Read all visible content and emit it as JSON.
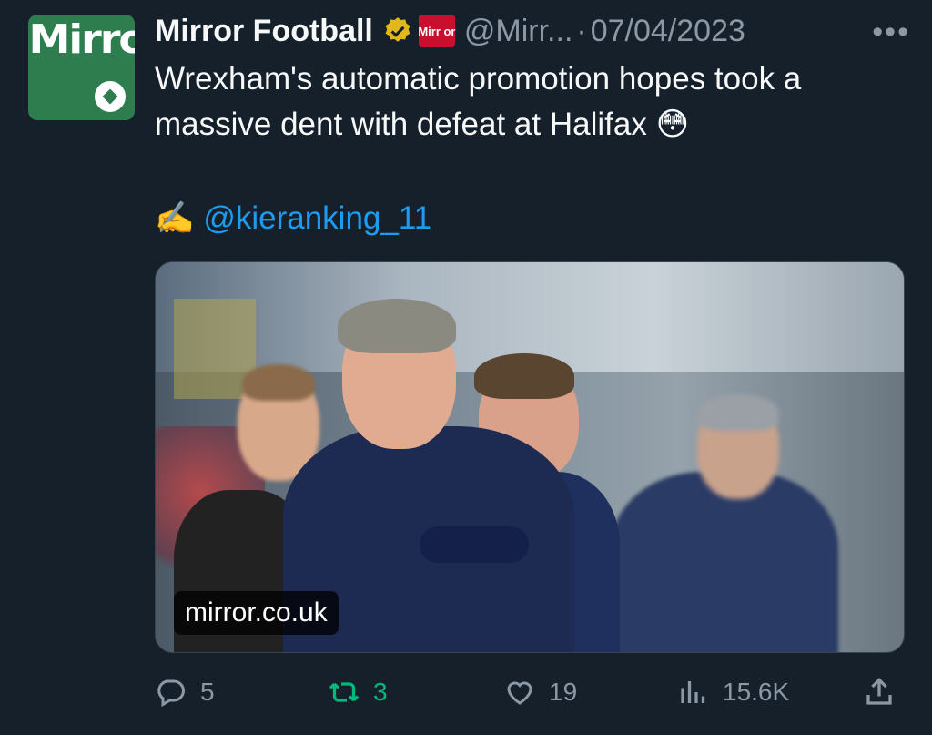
{
  "avatar": {
    "logo_text": "Mirror",
    "icon": "mirror-football-logo"
  },
  "author": {
    "name": "Mirror Football",
    "handle": "@Mirr...",
    "separator": "·",
    "date": "07/04/2023",
    "verified_icon": "gold-verified-badge",
    "affiliate_badge_text": "Mirr or",
    "more_label": "•••"
  },
  "tweet": {
    "line1": "Wrexham's automatic promotion hopes took a",
    "line2": "massive dent with defeat at Halifax",
    "line2_emoji": "😳",
    "byline_emoji": "✍️",
    "mention": "@kieranking_11"
  },
  "media": {
    "watermark": "mirror.co.uk"
  },
  "actions": {
    "replies": "5",
    "retweets": "3",
    "likes": "19",
    "views": "15.6K",
    "reply_icon": "reply-icon",
    "retweet_icon": "retweet-icon",
    "like_icon": "heart-icon",
    "views_icon": "views-icon",
    "share_icon": "share-icon"
  },
  "colors": {
    "background": "#15202b",
    "text": "#f7f9f9",
    "muted": "#8b98a5",
    "link": "#1d9bf0",
    "retweet_active": "#00ba7c",
    "brand_green": "#2e7d4f",
    "brand_red": "#c8102e"
  }
}
